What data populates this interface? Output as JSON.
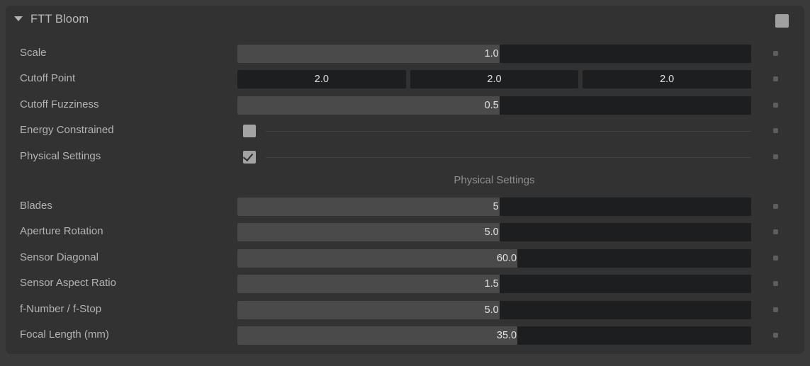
{
  "panel": {
    "title": "FTT Bloom",
    "disclosure_icon": "triangle-down-icon",
    "header_toggle_icon": "checkbox-filled-icon",
    "section_heading": "Physical Settings",
    "colors": {
      "outer_background": "#3a3a3a",
      "panel_background": "#323232",
      "slider_track": "#1d1e1f",
      "slider_fill": "#4a4a4a",
      "label_text": "#b3b3b3",
      "value_text": "#e2e2e2",
      "checkbox": "#a3a3a3",
      "dot": "#5e5e5e"
    },
    "rows": [
      {
        "label": "Scale",
        "type": "slider",
        "value": "1.0",
        "fill_percent": 51
      },
      {
        "label": "Cutoff Point",
        "type": "vector",
        "values": [
          "2.0",
          "2.0",
          "2.0"
        ]
      },
      {
        "label": "Cutoff Fuzziness",
        "type": "slider",
        "value": "0.5",
        "fill_percent": 51
      },
      {
        "label": "Energy Constrained",
        "type": "checkbox",
        "checked": false
      },
      {
        "label": "Physical Settings",
        "type": "checkbox",
        "checked": true
      },
      {
        "label": "Blades",
        "type": "slider",
        "value": "5",
        "fill_percent": 51
      },
      {
        "label": "Aperture Rotation",
        "type": "slider",
        "value": "5.0",
        "fill_percent": 51
      },
      {
        "label": "Sensor Diagonal",
        "type": "slider",
        "value": "60.0",
        "fill_percent": 54.5
      },
      {
        "label": "Sensor Aspect Ratio",
        "type": "slider",
        "value": "1.5",
        "fill_percent": 51
      },
      {
        "label": "f-Number / f-Stop",
        "type": "slider",
        "value": "5.0",
        "fill_percent": 51
      },
      {
        "label": "Focal Length (mm)",
        "type": "slider",
        "value": "35.0",
        "fill_percent": 54.5
      }
    ]
  }
}
